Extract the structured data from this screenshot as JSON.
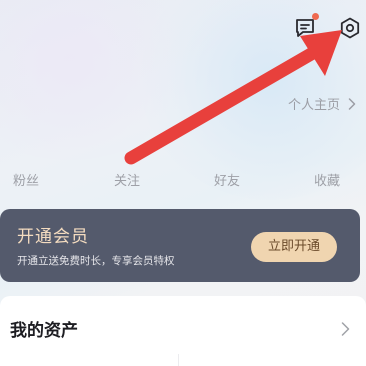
{
  "header": {
    "message_icon": "message-icon",
    "settings_icon": "gear-icon",
    "notification_color": "#ef6a50"
  },
  "profile": {
    "homepage_label": "个人主页"
  },
  "stats": [
    {
      "label": "粉丝"
    },
    {
      "label": "关注"
    },
    {
      "label": "好友"
    },
    {
      "label": "收藏"
    }
  ],
  "vip": {
    "title": "开通会员",
    "description": "开通立送免费时长，专享会员特权",
    "button_label": "立即开通",
    "card_color": "#545a6c",
    "button_color": "#f0d5b0"
  },
  "assets": {
    "title": "我的资产"
  },
  "annotation": {
    "arrow_color": "#e8403c"
  }
}
